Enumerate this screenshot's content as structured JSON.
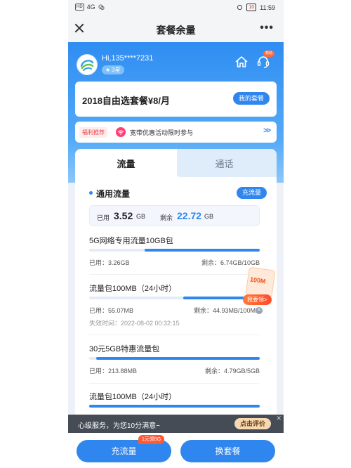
{
  "status_bar": {
    "left_chip": "HD",
    "signal": "4G",
    "time": "11:59",
    "battery": "10"
  },
  "title_bar": {
    "title": "套餐余量",
    "more": "•••"
  },
  "user": {
    "greeting": "Hi,135****7231",
    "stars": "3星",
    "service_badge": "帮助"
  },
  "plan": {
    "name": "2018自由选套餐¥8/月",
    "my_plan_button": "我的套餐"
  },
  "promo": {
    "tag": "福利推荐",
    "text": "宽带优惠活动限时参与",
    "arrow": ">>"
  },
  "tabs": {
    "data": "流量",
    "voice": "通话"
  },
  "general": {
    "title": "通用流量",
    "recharge": "充流量",
    "used_label": "已用",
    "used_value": "3.52",
    "used_unit": "GB",
    "left_label": "剩余",
    "left_value": "22.72",
    "left_unit": "GB"
  },
  "packages": [
    {
      "name": "5G网络专用流量10GB包",
      "used": "已用：3.26GB",
      "left": "剩余：6.74GB/10GB",
      "used_fraction": 0.326,
      "expiry": ""
    },
    {
      "name": "流量包100MB（24小时）",
      "used": "已用：55.07MB",
      "left": "剩余：44.93MB/100MB",
      "used_fraction": 0.5507,
      "expiry": "失效时间：2022-08-02 00:32:15"
    },
    {
      "name": "30元5GB特惠流量包",
      "used": "已用：213.88MB",
      "left": "剩余：4.79GB/5GB",
      "used_fraction": 0.042,
      "expiry": ""
    },
    {
      "name": "流量包100MB（24小时）",
      "used": "",
      "left": "",
      "used_fraction": 0.0,
      "expiry": ""
    }
  ],
  "gift": {
    "card_text": "100M",
    "button": "我要领>"
  },
  "survey": {
    "text": "心级服务，为您10分满意~",
    "button": "点击评价",
    "close": "✕"
  },
  "bottom": {
    "recharge": "充流量",
    "badge": "1元领5G",
    "change": "换套餐"
  },
  "colors": {
    "primary": "#2f86ee",
    "accent_orange": "#ff5a36"
  }
}
